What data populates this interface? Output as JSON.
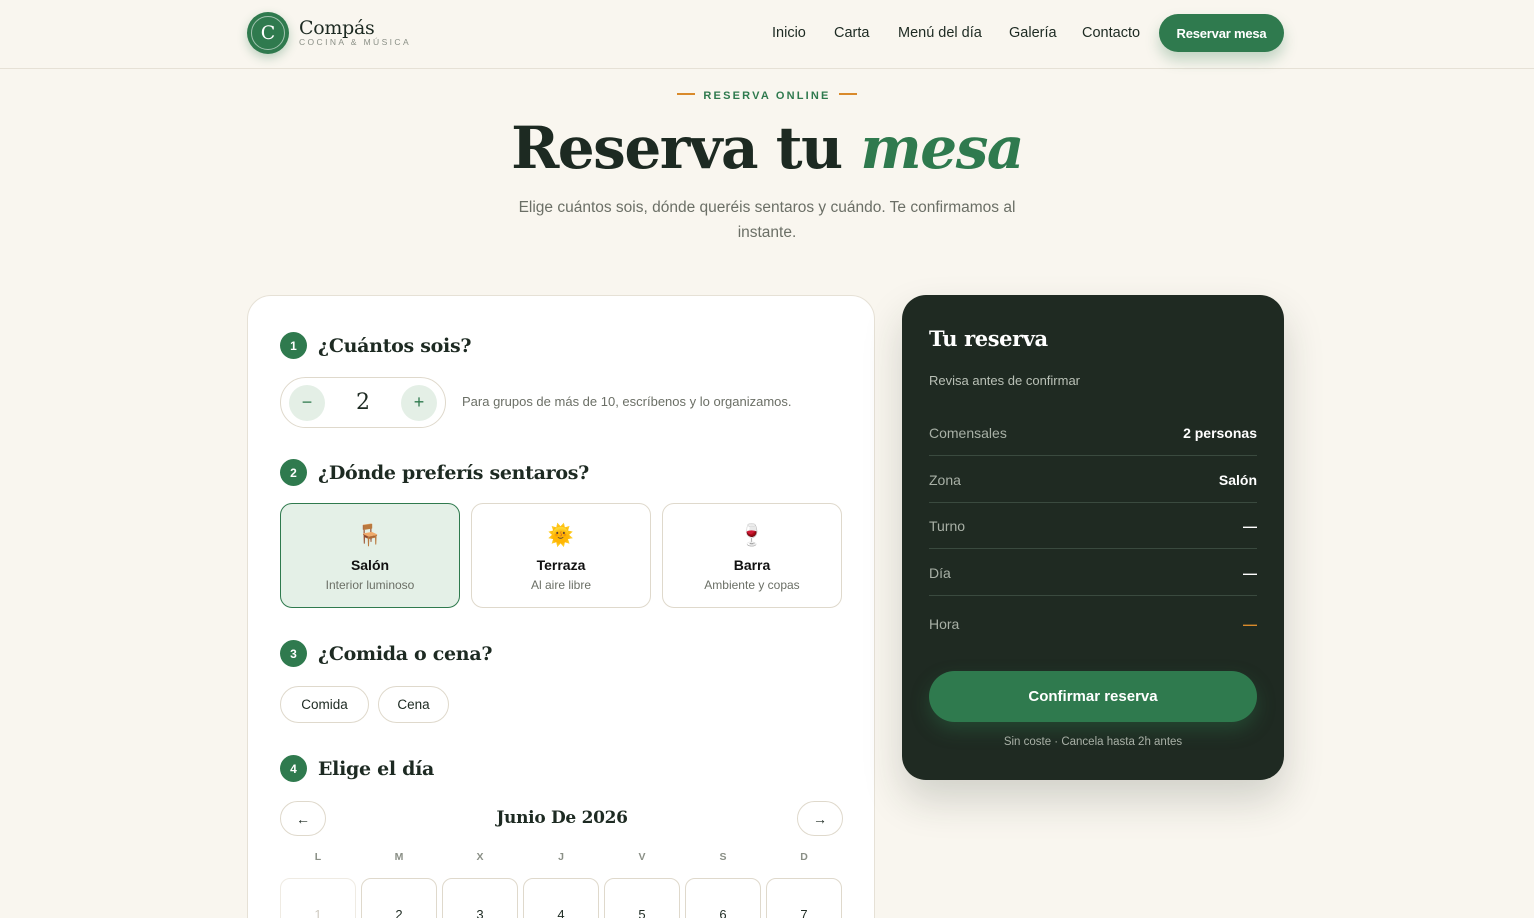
{
  "header": {
    "logo_letter": "C",
    "brand_name": "Compás",
    "brand_tagline": "COCINA & MÚSICA",
    "nav": [
      "Inicio",
      "Carta",
      "Menú del día",
      "Galería",
      "Contacto"
    ],
    "cta": "Reservar mesa"
  },
  "hero": {
    "eyebrow": "RESERVA ONLINE",
    "title_main": "Reserva tu",
    "title_accent": "mesa",
    "subtitle": "Elige cuántos sois, dónde queréis sentaros y cuándo. Te confirmamos al instante."
  },
  "form": {
    "steps": [
      {
        "num": "1",
        "title": "¿Cuántos sois?"
      },
      {
        "num": "2",
        "title": "¿Dónde preferís sentaros?"
      },
      {
        "num": "3",
        "title": "¿Comida o cena?"
      },
      {
        "num": "4",
        "title": "Elige el día"
      }
    ],
    "guests": {
      "minus": "−",
      "value": "2",
      "plus": "+",
      "hint": "Para grupos de más de 10, escríbenos y lo organizamos."
    },
    "zones": [
      {
        "icon": "🪑",
        "icon_name": "chair-icon",
        "name": "Salón",
        "desc": "Interior luminoso",
        "selected": true
      },
      {
        "icon": "🌞",
        "icon_name": "sun-icon",
        "name": "Terraza",
        "desc": "Al aire libre",
        "selected": false
      },
      {
        "icon": "🍷",
        "icon_name": "wine-glass-icon",
        "name": "Barra",
        "desc": "Ambiente y copas",
        "selected": false
      }
    ],
    "meal": [
      "Comida",
      "Cena"
    ],
    "calendar": {
      "prev": "←",
      "next": "→",
      "month": "Junio De 2026",
      "weekdays": [
        "L",
        "M",
        "X",
        "J",
        "V",
        "S",
        "D"
      ],
      "days": [
        "1",
        "2",
        "3",
        "4",
        "5",
        "6",
        "7"
      ]
    }
  },
  "summary": {
    "title": "Tu reserva",
    "subtitle": "Revisa antes de confirmar",
    "rows": [
      {
        "k": "Comensales",
        "v": "2 personas"
      },
      {
        "k": "Zona",
        "v": "Salón"
      },
      {
        "k": "Turno",
        "v": "—"
      },
      {
        "k": "Día",
        "v": "—"
      },
      {
        "k": "Hora",
        "v": "—"
      }
    ],
    "confirm": "Confirmar reserva",
    "note": "Sin coste · Cancela hasta 2h antes"
  },
  "colors": {
    "brand": "#2f7a4e",
    "accent": "#d98a2b",
    "dark_panel": "#1f2a22",
    "background": "#f9f6ef"
  }
}
